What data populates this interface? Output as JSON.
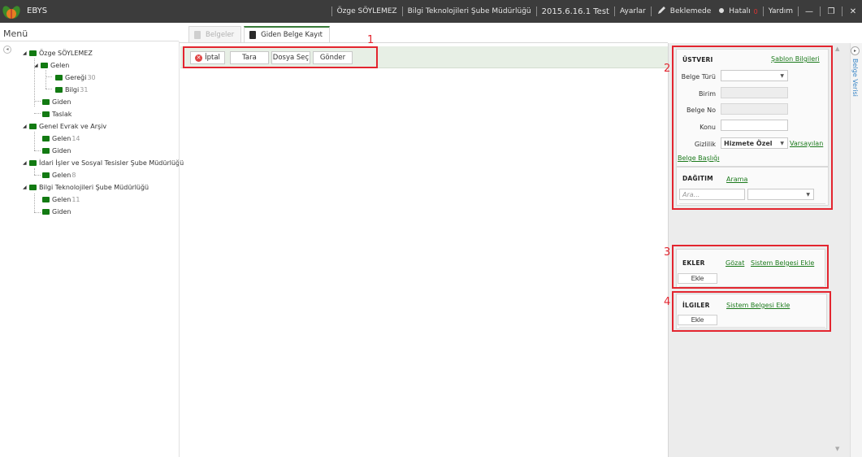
{
  "header": {
    "app_title": "EBYS",
    "user": "Özge SÖYLEMEZ",
    "department": "Bilgi Teknolojileri Şube Müdürlüğü",
    "version": "2015.6.16.1 Test",
    "settings": "Ayarlar",
    "pending": "Beklemede",
    "errors": "Hatalı",
    "errors_count": "0",
    "help": "Yardım",
    "minimize": "—",
    "restore": "❐",
    "close": "✕"
  },
  "menu": {
    "title": "Menü",
    "collapse": "◂",
    "tree": [
      {
        "label": "Özge SÖYLEMEZ",
        "count": ""
      },
      {
        "label": "Gelen",
        "count": ""
      },
      {
        "label": "Gereği",
        "count": "30"
      },
      {
        "label": "Bilgi",
        "count": "31"
      },
      {
        "label": "Giden",
        "count": ""
      },
      {
        "label": "Taslak",
        "count": ""
      },
      {
        "label": "Genel Evrak ve Arşiv",
        "count": ""
      },
      {
        "label": "Gelen",
        "count": "14"
      },
      {
        "label": "Giden",
        "count": ""
      },
      {
        "label": "İdari İşler ve Sosyal Tesisler Şube Müdürlüğü",
        "count": ""
      },
      {
        "label": "Gelen",
        "count": "8"
      },
      {
        "label": "Bilgi Teknolojileri Şube Müdürlüğü",
        "count": ""
      },
      {
        "label": "Gelen",
        "count": "11"
      },
      {
        "label": "Giden",
        "count": ""
      }
    ]
  },
  "tabs": [
    {
      "label": "Belgeler"
    },
    {
      "label": "Giden Belge Kayıt"
    }
  ],
  "toolbar": {
    "cancel": "İptal",
    "scan": "Tara",
    "choose_file": "Dosya Seç",
    "send": "Gönder"
  },
  "annotations": [
    "1",
    "2",
    "3",
    "4"
  ],
  "metadata_panel": {
    "title": "ÜSTVERI",
    "template_link": "Şablon Bilgileri",
    "doc_type_label": "Belge Türü",
    "doc_type_value": "",
    "unit_label": "Birim",
    "unit_value": "",
    "doc_no_label": "Belge No",
    "doc_no_value": "",
    "subject_label": "Konu",
    "subject_value": "",
    "privacy_label": "Gizlilik",
    "privacy_value": "Hizmete Özel",
    "default_link": "Varsayılan",
    "doc_header_link": "Belge Başlığı"
  },
  "distribution": {
    "title": "DAĞITIM",
    "search_link": "Arama",
    "search_placeholder": "Ara...",
    "select_value": ""
  },
  "attachments": {
    "title": "EKLER",
    "browse_link": "Gözat",
    "system_doc_link": "Sistem Belgesi Ekle",
    "add_button": "Ekle"
  },
  "related": {
    "title": "İLGILER",
    "system_doc_link": "Sistem Belgesi Ekle",
    "add_button": "Ekle"
  },
  "side_panel": {
    "toggle": "▸",
    "label": "Belge Verisi"
  },
  "colors": {
    "topbar": "#3c3c3c",
    "folder": "#127a12",
    "link": "#1c7a1c",
    "annotation": "#e3252f",
    "toolbar_bg": "#e7efe5"
  }
}
